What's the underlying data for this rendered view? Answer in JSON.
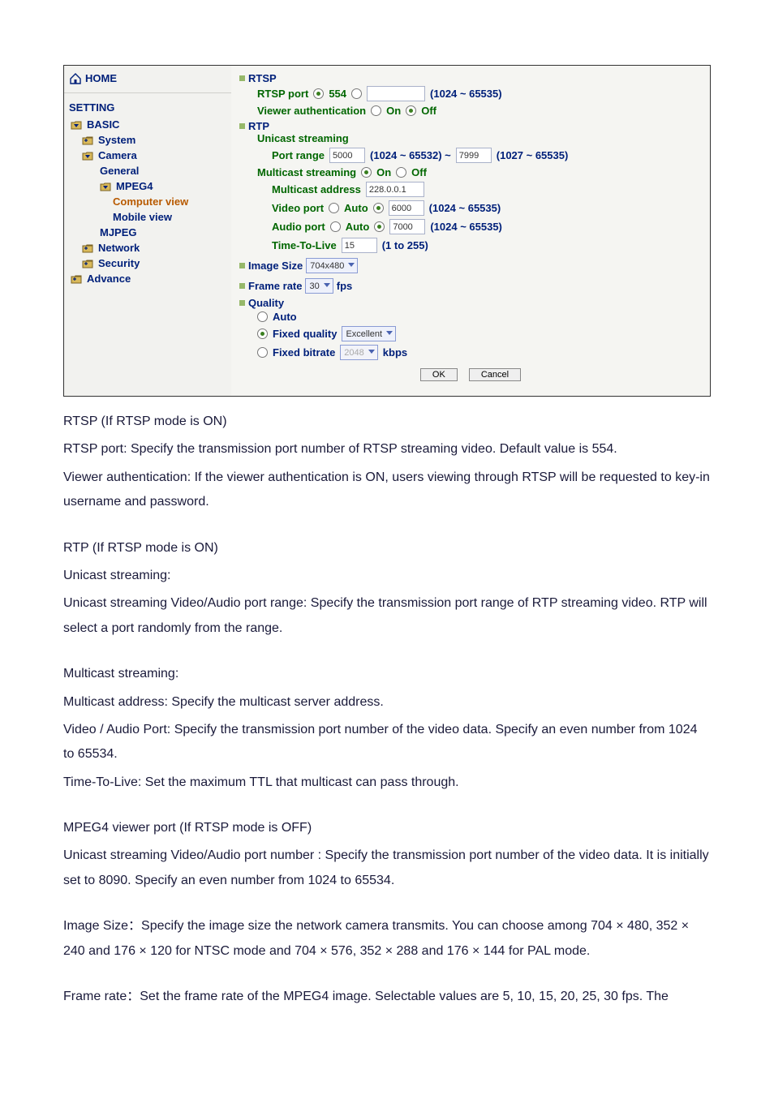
{
  "sidebar": {
    "home": "HOME",
    "heading": "SETTING",
    "items": [
      {
        "label": "BASIC",
        "icon": "folder-open-down",
        "depth": 0
      },
      {
        "label": "System",
        "icon": "folder-closed",
        "depth": 1
      },
      {
        "label": "Camera",
        "icon": "folder-open-down",
        "depth": 1
      },
      {
        "label": "General",
        "icon": "",
        "depth": 2
      },
      {
        "label": "MPEG4",
        "icon": "folder-open-down",
        "depth": 2
      },
      {
        "label": "Computer view",
        "icon": "",
        "depth": 3,
        "active": true
      },
      {
        "label": "Mobile view",
        "icon": "",
        "depth": 3
      },
      {
        "label": "MJPEG",
        "icon": "",
        "depth": 2
      },
      {
        "label": "Network",
        "icon": "folder-closed",
        "depth": 1
      },
      {
        "label": "Security",
        "icon": "folder-closed",
        "depth": 1
      },
      {
        "label": "Advance",
        "icon": "folder-closed",
        "depth": 0
      }
    ]
  },
  "panel": {
    "rtsp": {
      "title": "RTSP",
      "port_label": "RTSP port",
      "port_option_554": "554",
      "port_custom_value": "",
      "port_range": "(1024 ~ 65535)",
      "viewer_auth_label": "Viewer authentication",
      "on": "On",
      "off": "Off"
    },
    "rtp": {
      "title": "RTP",
      "unicast_heading": "Unicast streaming",
      "portrange_label": "Port range",
      "portrange_from": "5000",
      "portrange_from_range": "(1024 ~ 65532) ~",
      "portrange_to": "7999",
      "portrange_to_range": "(1027 ~ 65535)",
      "multicast_label": "Multicast streaming",
      "multicast_addr_label": "Multicast address",
      "multicast_addr_value": "228.0.0.1",
      "video_port_label": "Video port",
      "auto": "Auto",
      "video_port_value": "6000",
      "video_port_range": "(1024 ~ 65535)",
      "audio_port_label": "Audio port",
      "audio_port_value": "7000",
      "audio_port_range": "(1024 ~ 65535)",
      "ttl_label": "Time-To-Live",
      "ttl_value": "15",
      "ttl_range": "(1 to 255)"
    },
    "image_size": {
      "label": "Image Size",
      "value": "704x480"
    },
    "frame_rate": {
      "label": "Frame rate",
      "value": "30",
      "unit": "fps"
    },
    "quality": {
      "label": "Quality",
      "auto": "Auto",
      "fixed_quality_label": "Fixed quality",
      "fixed_quality_value": "Excellent",
      "fixed_bitrate_label": "Fixed bitrate",
      "fixed_bitrate_value": "2048",
      "kbps": "kbps"
    },
    "buttons": {
      "ok": "OK",
      "cancel": "Cancel"
    }
  },
  "doc": {
    "p1": "RTSP (If RTSP mode is ON)",
    "p2": "RTSP port: Specify the transmission port number of RTSP streaming video. Default value is 554.",
    "p3": "Viewer authentication: If the viewer authentication is ON, users viewing through RTSP will be requested to key-in username and password.",
    "p4": "RTP (If RTSP mode is ON)",
    "p5": "Unicast streaming:",
    "p6": "Unicast streaming Video/Audio port range: Specify the transmission port range of RTP streaming video. RTP will select a port randomly from the range.",
    "p7": "Multicast streaming:",
    "p8": "Multicast address: Specify the multicast server address.",
    "p9": "Video / Audio Port: Specify the transmission port number of the video data. Specify an even number from 1024 to 65534.",
    "p10": "Time-To-Live: Set the maximum TTL that multicast can pass through.",
    "p11": "MPEG4 viewer port (If RTSP mode is OFF)",
    "p12": "Unicast streaming Video/Audio port number : Specify the transmission port number of the video data. It is initially set to 8090. Specify an even number from 1024 to 65534.",
    "p13": "Image Size：Specify the image size the network camera transmits. You can choose among 704 × 480, 352 × 240 and 176 × 120 for NTSC mode and 704 × 576, 352 × 288 and 176 × 144 for PAL mode.",
    "p14": "Frame rate：Set the frame rate of the MPEG4 image. Selectable values are 5, 10, 15, 20, 25, 30 fps. The"
  }
}
